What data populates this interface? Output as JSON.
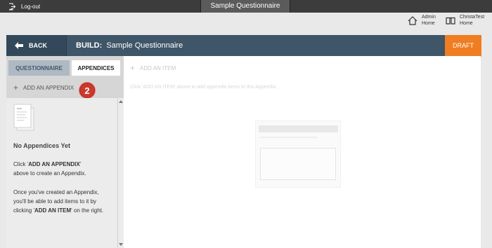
{
  "topbar": {
    "logout_label": "Log-out",
    "title": "Sample Questionnaire"
  },
  "header": {
    "admin_line1": "Admin",
    "admin_line2": "Home",
    "user_line1": "ChristaTest",
    "user_line2": "Home"
  },
  "build": {
    "back_label": "BACK",
    "build_prefix": "BUILD:",
    "questionnaire_name": "Sample Questionnaire",
    "status": "DRAFT"
  },
  "tabs": {
    "questionnaire": "QUESTIONNAIRE",
    "appendices": "APPENDICES"
  },
  "left": {
    "add_appendix_label": "ADD AN APPENDIX",
    "step_badge": "2",
    "empty_title": "No Appendices Yet",
    "help1_pre": "Click '",
    "help1_bold": "ADD AN APPENDIX",
    "help1_post": "'",
    "help1_line2": "above to create an Appendix.",
    "help2_line1": "Once you've created an Appendix,",
    "help2_line2": "you'll be able to add items to it by",
    "help2_pre": "clicking '",
    "help2_bold": "ADD AN ITEM",
    "help2_post": "' on the right."
  },
  "content": {
    "add_item_label": "ADD AN ITEM",
    "hint": "Click 'ADD AN ITEM' above to add appendix items to this Appendix."
  },
  "colors": {
    "topbar": "#3c3c3c",
    "buildbar": "#3f5568",
    "draft": "#f07d22",
    "badge": "#c93a2a"
  }
}
